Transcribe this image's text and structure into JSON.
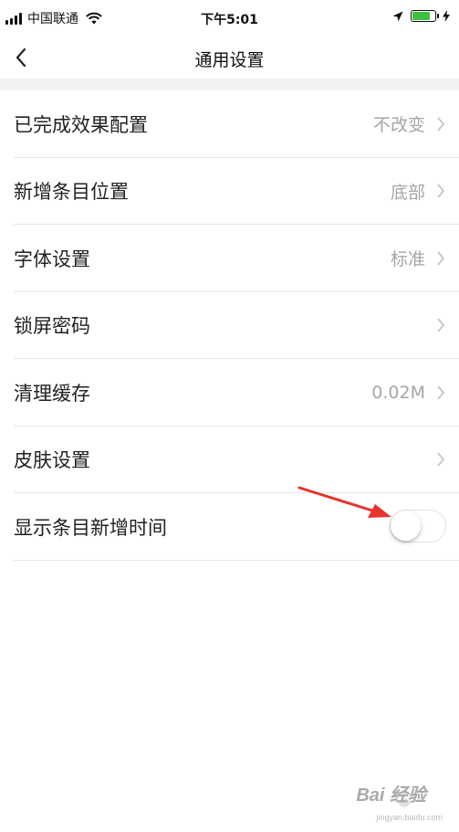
{
  "status_bar": {
    "carrier": "中国联通",
    "time": "下午5:01",
    "signal_bars": 4,
    "battery_level": 0.8,
    "icons": [
      "signal-icon",
      "wifi-icon",
      "location-icon",
      "battery-icon",
      "charging-icon"
    ]
  },
  "nav": {
    "title": "通用设置",
    "back_icon": "chevron-left-icon"
  },
  "settings": [
    {
      "label": "已完成效果配置",
      "value": "不改变",
      "has_chevron": true
    },
    {
      "label": "新增条目位置",
      "value": "底部",
      "has_chevron": true
    },
    {
      "label": "字体设置",
      "value": "标准",
      "has_chevron": true
    },
    {
      "label": "锁屏密码",
      "value": "",
      "has_chevron": true
    },
    {
      "label": "清理缓存",
      "value": "0.02M",
      "has_chevron": true
    },
    {
      "label": "皮肤设置",
      "value": "",
      "has_chevron": true
    },
    {
      "label": "显示条目新增时间",
      "toggle": false
    }
  ],
  "colors": {
    "accent_arrow": "#e8322b",
    "battery": "#3ec13e",
    "secondary_text": "#a6a6a6",
    "separator": "#e6e6e6"
  },
  "watermark": {
    "logo_text": "Bai 经验",
    "sub_text": "jingyan.baidu.com"
  }
}
